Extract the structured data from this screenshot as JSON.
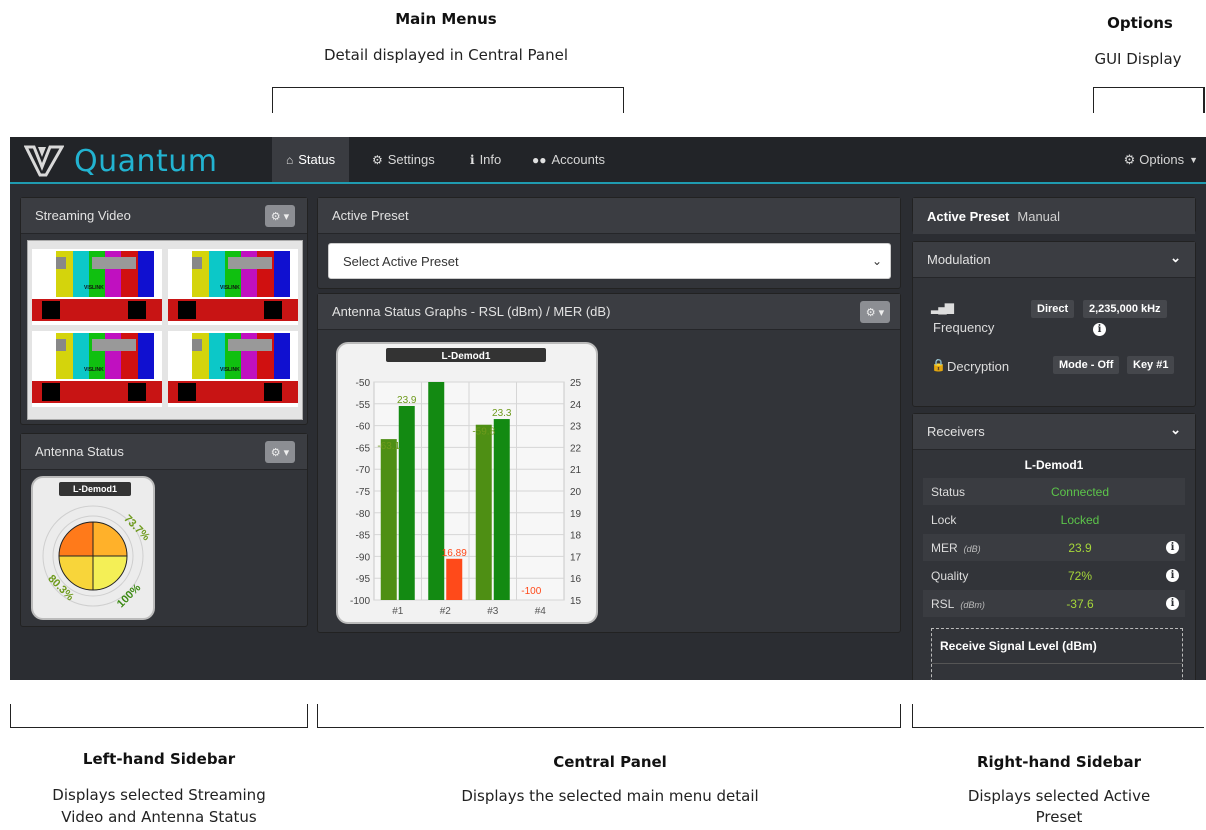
{
  "annotations": {
    "main_menus_title": "Main Menus",
    "main_menus_desc": "Detail displayed in Central Panel",
    "options_title": "Options",
    "options_desc": "GUI Display",
    "left_title": "Left-hand Sidebar",
    "left_desc_1": "Displays selected Streaming",
    "left_desc_2": "Video and Antenna Status",
    "central_title": "Central Panel",
    "central_desc": "Displays the selected main menu detail",
    "right_title": "Right-hand Sidebar",
    "right_desc_1": "Displays selected Active",
    "right_desc_2": "Preset"
  },
  "app": {
    "brand": "Quantum",
    "accent": "#22b3d1",
    "nav": [
      {
        "label": "Status",
        "icon": "home-icon",
        "active": true
      },
      {
        "label": "Settings",
        "icon": "gears-icon",
        "active": false
      },
      {
        "label": "Info",
        "icon": "info-icon",
        "active": false
      },
      {
        "label": "Accounts",
        "icon": "users-icon",
        "active": false
      }
    ],
    "options_label": "Options"
  },
  "left_sidebar": {
    "streaming_title": "Streaming Video",
    "video_tile_text": "VISLINK",
    "antenna_title": "Antenna Status",
    "antenna_widget": {
      "label": "L-Demod1",
      "quadrants": [
        "73.7%",
        "100%",
        "80.3%"
      ]
    }
  },
  "central": {
    "active_preset_title": "Active Preset",
    "select_placeholder": "Select Active Preset",
    "graph_title": "Antenna Status Graphs - RSL (dBm) / MER (dB)",
    "chart_data": {
      "type": "bar",
      "title": "L-Demod1",
      "categories": [
        "#1",
        "#2",
        "#3",
        "#4"
      ],
      "series": [
        {
          "axis": "left",
          "values": [
            -63.1,
            -50,
            -59.8,
            -100
          ],
          "value_labels": [
            "-63.1",
            "",
            "-59.8",
            "-100"
          ]
        },
        {
          "axis": "right",
          "values": [
            23.9,
            25,
            23.3,
            15
          ],
          "value_labels": [
            "23.9",
            "",
            "23.3",
            ""
          ]
        }
      ],
      "alarm_bar": {
        "category": "#2",
        "value": 16.89,
        "label": "16.89",
        "color": "#ff4a1a"
      },
      "left_axis": {
        "ylim": [
          -100,
          -50
        ],
        "ticks": [
          -50,
          -55,
          -60,
          -65,
          -70,
          -75,
          -80,
          -85,
          -90,
          -95,
          -100
        ]
      },
      "right_axis": {
        "ylim": [
          15,
          25
        ],
        "ticks": [
          25,
          24,
          23,
          22,
          21,
          20,
          19,
          18,
          17,
          16,
          15
        ]
      },
      "grid": true,
      "colors": {
        "dark_green": "#138a12",
        "olive": "#4e8f14",
        "orange": "#ff4a1a",
        "label_olive": "#6e9a1c"
      }
    }
  },
  "right_sidebar": {
    "active_preset_label": "Active Preset",
    "active_preset_value": "Manual",
    "modulation_title": "Modulation",
    "frequency_label": "Frequency",
    "direct_label": "Direct",
    "frequency_value": "2,235,000 kHz",
    "decryption_label": "Decryption",
    "mode_value": "Mode - Off",
    "key_value": "Key #1",
    "receivers_title": "Receivers",
    "receiver_name": "L-Demod1",
    "rows": [
      {
        "label": "Status",
        "unit": "",
        "value": "Connected",
        "info": false
      },
      {
        "label": "Lock",
        "unit": "",
        "value": "Locked",
        "info": false
      },
      {
        "label": "MER",
        "unit": "(dB)",
        "value": "23.9",
        "info": true
      },
      {
        "label": "Quality",
        "unit": "",
        "value": "72%",
        "info": true
      },
      {
        "label": "RSL",
        "unit": "(dBm)",
        "value": "-37.6",
        "info": true
      }
    ],
    "rsl_graph_title": "Receive Signal Level (dBm)"
  }
}
